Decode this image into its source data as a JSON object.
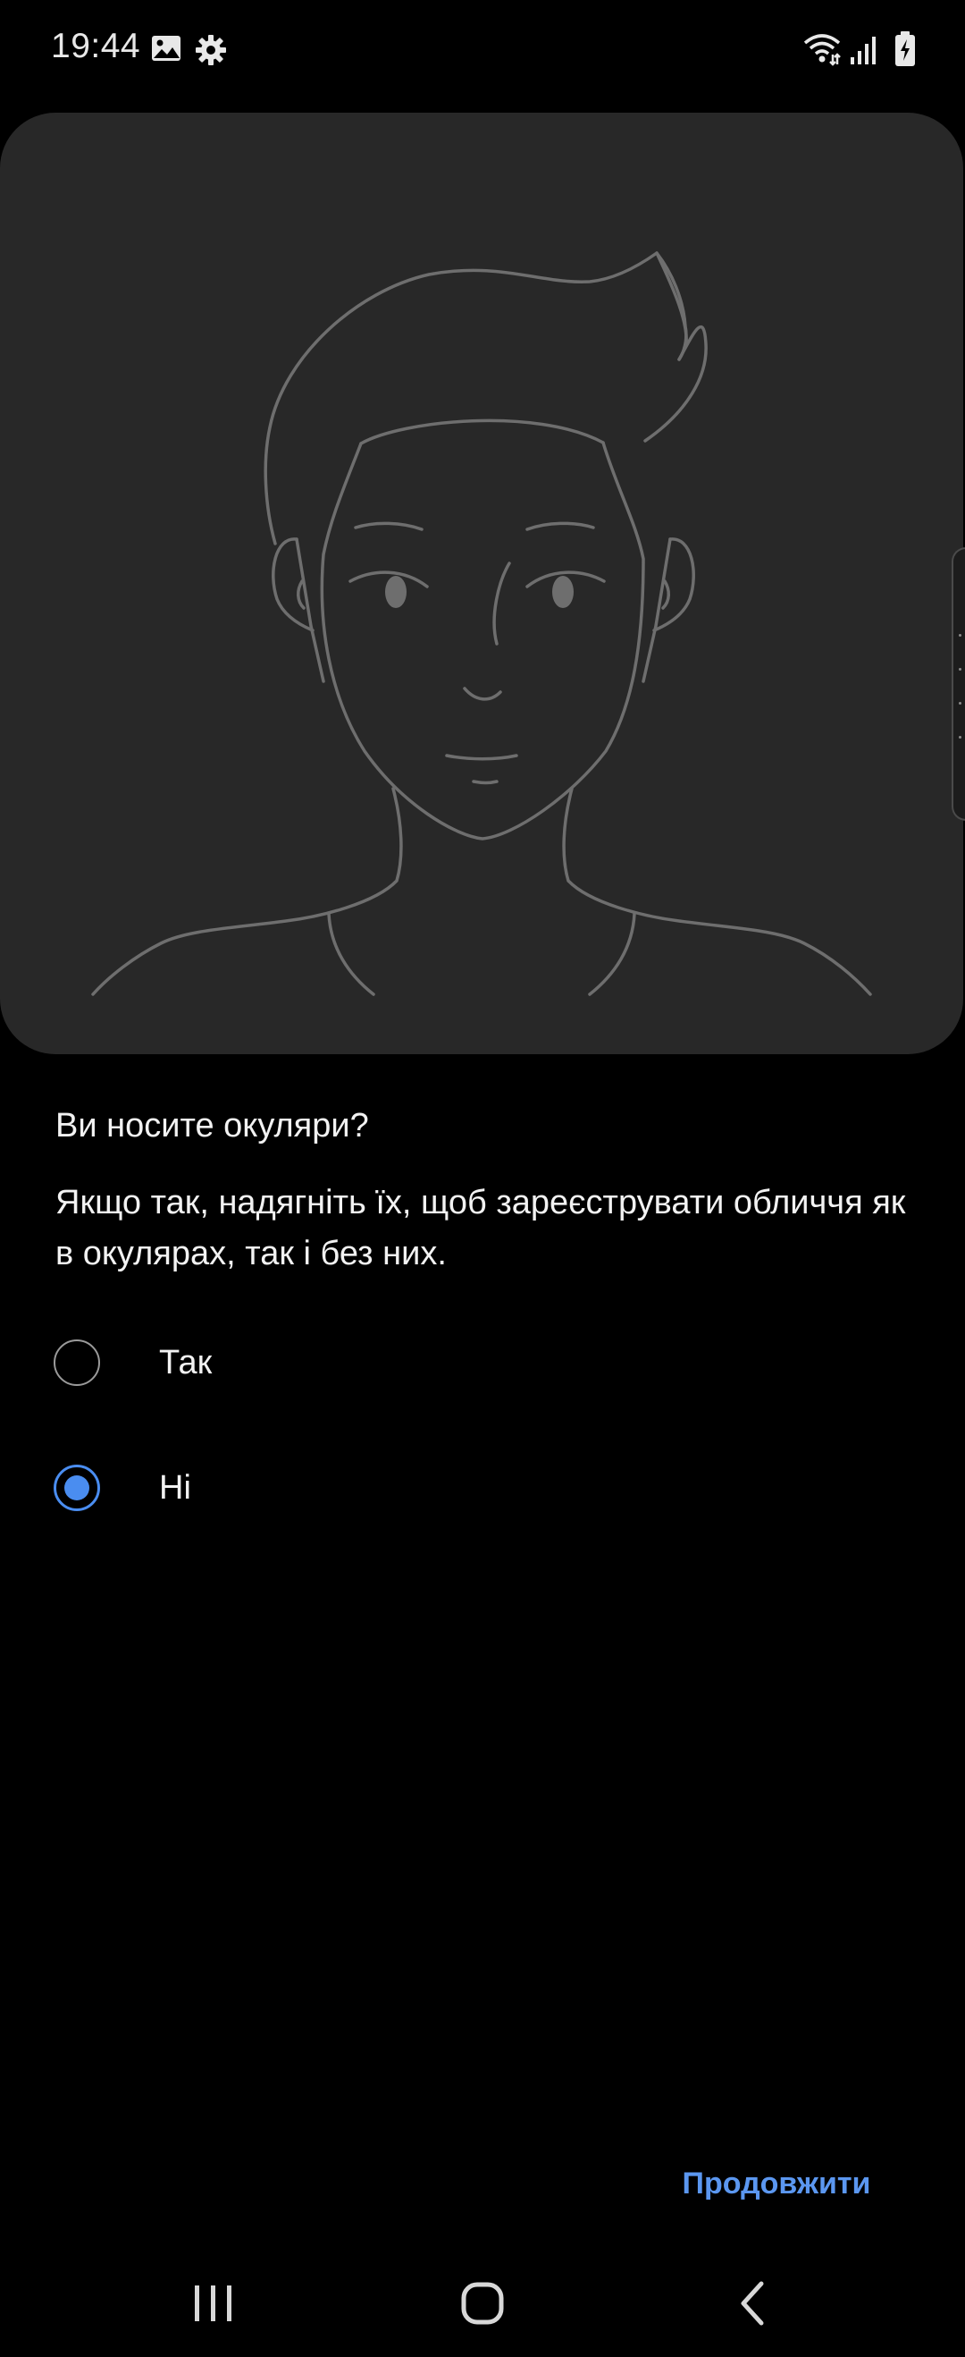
{
  "status_bar": {
    "time": "19:44",
    "left_icons": [
      "image-icon",
      "gear-icon"
    ],
    "right_icons": [
      "wifi-icon",
      "signal-icon",
      "battery-charging-icon"
    ]
  },
  "illustration": {
    "icon": "face-outline-illustration"
  },
  "content": {
    "question": "Ви носите окуляри?",
    "description": "Якщо так, надягніть їх, щоб зареєструвати обличчя як в окулярах, так і без них."
  },
  "options": [
    {
      "label": "Так",
      "selected": false
    },
    {
      "label": "Ні",
      "selected": true
    }
  ],
  "actions": {
    "continue_label": "Продовжити"
  },
  "nav_bar": {
    "icons": [
      "recent-apps-icon",
      "home-icon",
      "back-icon"
    ]
  },
  "colors": {
    "accent": "#4a8df0",
    "link": "#5b97f0",
    "card_background": "#282828",
    "background": "#000000"
  }
}
